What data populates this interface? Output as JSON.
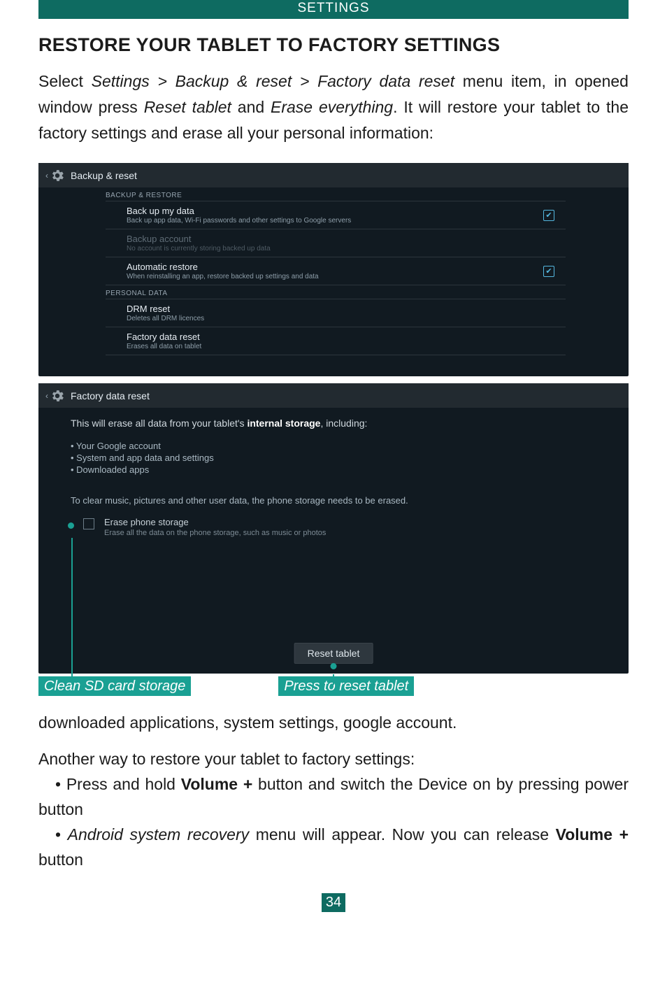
{
  "header": {
    "title": "SETTINGS"
  },
  "heading": "RESTORE YOUR TABLET TO FACTORY SETTINGS",
  "intro": {
    "t1": "Select ",
    "path": "Settings > Backup & reset > Factory data reset",
    "t2": " menu item, in opened window press ",
    "reset_tablet": "Reset tablet",
    "t3": " and ",
    "erase_everything": "Erase everything",
    "t4": ". It will restore your tablet to the factory settings and erase all your personal information:"
  },
  "ss1": {
    "title": "Backup & reset",
    "section_backup": "BACKUP & RESTORE",
    "rows_backup": [
      {
        "t": "Back up my data",
        "s": "Back up app data, Wi-Fi passwords and other settings to Google servers",
        "check": true,
        "dim": false
      },
      {
        "t": "Backup account",
        "s": "No account is currently storing backed up data",
        "check": false,
        "dim": true
      },
      {
        "t": "Automatic restore",
        "s": "When reinstalling an app, restore backed up settings and data",
        "check": true,
        "dim": false
      }
    ],
    "section_personal": "PERSONAL DATA",
    "rows_personal": [
      {
        "t": "DRM reset",
        "s": "Deletes all DRM licences"
      },
      {
        "t": "Factory data reset",
        "s": "Erases all data on tablet"
      }
    ]
  },
  "ss2": {
    "title": "Factory data reset",
    "intro_a": "This will erase all data from your tablet's ",
    "intro_b": "internal storage",
    "intro_c": ", including:",
    "bullets": "• Your Google account\n• System and app data and settings\n• Downloaded apps",
    "note": "To clear music, pictures and other user data, the phone storage needs to be erased.",
    "checkbox": {
      "t": "Erase phone storage",
      "s": "Erase all the data on the phone storage, such as music or photos"
    },
    "button": "Reset tablet"
  },
  "callouts": {
    "c1": "Clean SD card storage",
    "c2": "Press to reset tablet"
  },
  "after": {
    "line1": "downloaded applications, system settings, google account.",
    "line2": "Another way to restore your tablet to factory settings:",
    "b1_a": "Press and hold ",
    "b1_b": "Volume +",
    "b1_c": " button and switch the Device on by pressing power button",
    "b2_a": "Android system recovery",
    "b2_b": " menu will appear. Now you can release ",
    "b2_c": "Volume +",
    "b2_d": " button"
  },
  "page_number": "34"
}
